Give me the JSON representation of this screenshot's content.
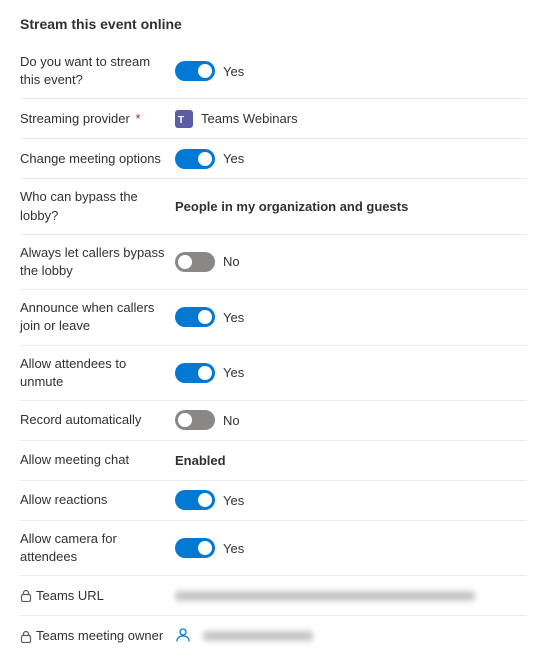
{
  "page": {
    "title": "Stream this event online"
  },
  "rows": [
    {
      "id": "stream-event",
      "label": "Do you want to stream this event?",
      "type": "toggle",
      "toggleState": "on",
      "valueText": "Yes",
      "hasLock": false
    },
    {
      "id": "streaming-provider",
      "label": "Streaming provider",
      "required": true,
      "type": "provider",
      "valueText": "Teams Webinars",
      "hasLock": false
    },
    {
      "id": "change-meeting-options",
      "label": "Change meeting options",
      "type": "toggle",
      "toggleState": "on",
      "valueText": "Yes",
      "hasLock": false
    },
    {
      "id": "bypass-lobby",
      "label": "Who can bypass the lobby?",
      "type": "text",
      "valueText": "People in my organization and guests",
      "bold": true,
      "hasLock": false
    },
    {
      "id": "callers-bypass-lobby",
      "label": "Always let callers bypass the lobby",
      "type": "toggle",
      "toggleState": "off",
      "valueText": "No",
      "hasLock": false
    },
    {
      "id": "announce-callers",
      "label": "Announce when callers join or leave",
      "type": "toggle",
      "toggleState": "on",
      "valueText": "Yes",
      "hasLock": false
    },
    {
      "id": "allow-unmute",
      "label": "Allow attendees to unmute",
      "type": "toggle",
      "toggleState": "on",
      "valueText": "Yes",
      "hasLock": false
    },
    {
      "id": "record-automatically",
      "label": "Record automatically",
      "type": "toggle",
      "toggleState": "off",
      "valueText": "No",
      "hasLock": false
    },
    {
      "id": "allow-meeting-chat",
      "label": "Allow meeting chat",
      "type": "text",
      "valueText": "Enabled",
      "bold": true,
      "hasLock": false
    },
    {
      "id": "allow-reactions",
      "label": "Allow reactions",
      "type": "toggle",
      "toggleState": "on",
      "valueText": "Yes",
      "hasLock": false
    },
    {
      "id": "allow-camera",
      "label": "Allow camera for attendees",
      "type": "toggle",
      "toggleState": "on",
      "valueText": "Yes",
      "hasLock": false
    },
    {
      "id": "teams-url",
      "label": "Teams URL",
      "type": "blurred",
      "hasLock": true,
      "blurWidths": [
        220
      ]
    },
    {
      "id": "teams-meeting-owner",
      "label": "Teams meeting owner",
      "type": "person",
      "hasLock": true,
      "blurWidths": [
        100
      ]
    }
  ],
  "labels": {
    "yes": "Yes",
    "no": "No",
    "enabled": "Enabled",
    "teamsWebinars": "Teams Webinars",
    "bypassLobbyValue": "People in my organization and guests",
    "teamsUrl": "Teams URL",
    "teamsMeetingOwner": "Teams meeting owner"
  }
}
